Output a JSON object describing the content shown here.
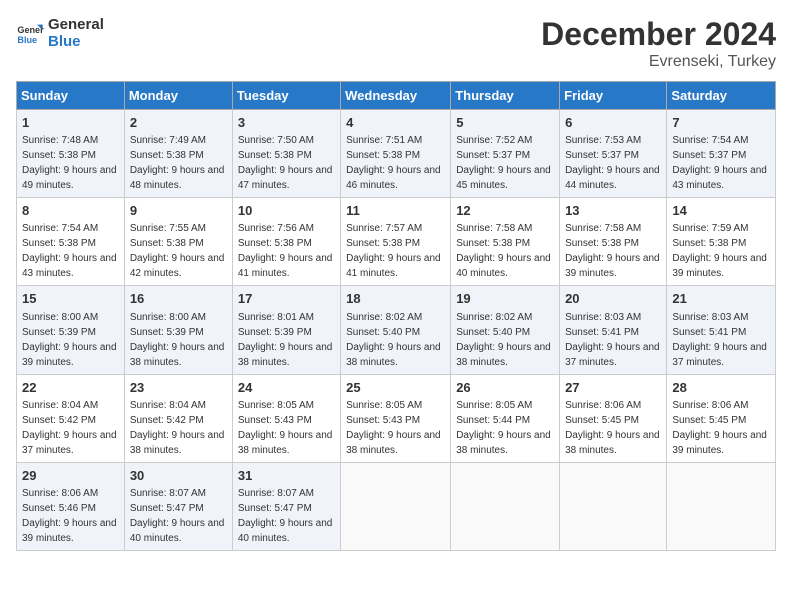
{
  "logo": {
    "line1": "General",
    "line2": "Blue"
  },
  "title": "December 2024",
  "location": "Evrenseki, Turkey",
  "days_of_week": [
    "Sunday",
    "Monday",
    "Tuesday",
    "Wednesday",
    "Thursday",
    "Friday",
    "Saturday"
  ],
  "weeks": [
    [
      {
        "day": "1",
        "sunrise": "Sunrise: 7:48 AM",
        "sunset": "Sunset: 5:38 PM",
        "daylight": "Daylight: 9 hours and 49 minutes."
      },
      {
        "day": "2",
        "sunrise": "Sunrise: 7:49 AM",
        "sunset": "Sunset: 5:38 PM",
        "daylight": "Daylight: 9 hours and 48 minutes."
      },
      {
        "day": "3",
        "sunrise": "Sunrise: 7:50 AM",
        "sunset": "Sunset: 5:38 PM",
        "daylight": "Daylight: 9 hours and 47 minutes."
      },
      {
        "day": "4",
        "sunrise": "Sunrise: 7:51 AM",
        "sunset": "Sunset: 5:38 PM",
        "daylight": "Daylight: 9 hours and 46 minutes."
      },
      {
        "day": "5",
        "sunrise": "Sunrise: 7:52 AM",
        "sunset": "Sunset: 5:37 PM",
        "daylight": "Daylight: 9 hours and 45 minutes."
      },
      {
        "day": "6",
        "sunrise": "Sunrise: 7:53 AM",
        "sunset": "Sunset: 5:37 PM",
        "daylight": "Daylight: 9 hours and 44 minutes."
      },
      {
        "day": "7",
        "sunrise": "Sunrise: 7:54 AM",
        "sunset": "Sunset: 5:37 PM",
        "daylight": "Daylight: 9 hours and 43 minutes."
      }
    ],
    [
      {
        "day": "8",
        "sunrise": "Sunrise: 7:54 AM",
        "sunset": "Sunset: 5:38 PM",
        "daylight": "Daylight: 9 hours and 43 minutes."
      },
      {
        "day": "9",
        "sunrise": "Sunrise: 7:55 AM",
        "sunset": "Sunset: 5:38 PM",
        "daylight": "Daylight: 9 hours and 42 minutes."
      },
      {
        "day": "10",
        "sunrise": "Sunrise: 7:56 AM",
        "sunset": "Sunset: 5:38 PM",
        "daylight": "Daylight: 9 hours and 41 minutes."
      },
      {
        "day": "11",
        "sunrise": "Sunrise: 7:57 AM",
        "sunset": "Sunset: 5:38 PM",
        "daylight": "Daylight: 9 hours and 41 minutes."
      },
      {
        "day": "12",
        "sunrise": "Sunrise: 7:58 AM",
        "sunset": "Sunset: 5:38 PM",
        "daylight": "Daylight: 9 hours and 40 minutes."
      },
      {
        "day": "13",
        "sunrise": "Sunrise: 7:58 AM",
        "sunset": "Sunset: 5:38 PM",
        "daylight": "Daylight: 9 hours and 39 minutes."
      },
      {
        "day": "14",
        "sunrise": "Sunrise: 7:59 AM",
        "sunset": "Sunset: 5:38 PM",
        "daylight": "Daylight: 9 hours and 39 minutes."
      }
    ],
    [
      {
        "day": "15",
        "sunrise": "Sunrise: 8:00 AM",
        "sunset": "Sunset: 5:39 PM",
        "daylight": "Daylight: 9 hours and 39 minutes."
      },
      {
        "day": "16",
        "sunrise": "Sunrise: 8:00 AM",
        "sunset": "Sunset: 5:39 PM",
        "daylight": "Daylight: 9 hours and 38 minutes."
      },
      {
        "day": "17",
        "sunrise": "Sunrise: 8:01 AM",
        "sunset": "Sunset: 5:39 PM",
        "daylight": "Daylight: 9 hours and 38 minutes."
      },
      {
        "day": "18",
        "sunrise": "Sunrise: 8:02 AM",
        "sunset": "Sunset: 5:40 PM",
        "daylight": "Daylight: 9 hours and 38 minutes."
      },
      {
        "day": "19",
        "sunrise": "Sunrise: 8:02 AM",
        "sunset": "Sunset: 5:40 PM",
        "daylight": "Daylight: 9 hours and 38 minutes."
      },
      {
        "day": "20",
        "sunrise": "Sunrise: 8:03 AM",
        "sunset": "Sunset: 5:41 PM",
        "daylight": "Daylight: 9 hours and 37 minutes."
      },
      {
        "day": "21",
        "sunrise": "Sunrise: 8:03 AM",
        "sunset": "Sunset: 5:41 PM",
        "daylight": "Daylight: 9 hours and 37 minutes."
      }
    ],
    [
      {
        "day": "22",
        "sunrise": "Sunrise: 8:04 AM",
        "sunset": "Sunset: 5:42 PM",
        "daylight": "Daylight: 9 hours and 37 minutes."
      },
      {
        "day": "23",
        "sunrise": "Sunrise: 8:04 AM",
        "sunset": "Sunset: 5:42 PM",
        "daylight": "Daylight: 9 hours and 38 minutes."
      },
      {
        "day": "24",
        "sunrise": "Sunrise: 8:05 AM",
        "sunset": "Sunset: 5:43 PM",
        "daylight": "Daylight: 9 hours and 38 minutes."
      },
      {
        "day": "25",
        "sunrise": "Sunrise: 8:05 AM",
        "sunset": "Sunset: 5:43 PM",
        "daylight": "Daylight: 9 hours and 38 minutes."
      },
      {
        "day": "26",
        "sunrise": "Sunrise: 8:05 AM",
        "sunset": "Sunset: 5:44 PM",
        "daylight": "Daylight: 9 hours and 38 minutes."
      },
      {
        "day": "27",
        "sunrise": "Sunrise: 8:06 AM",
        "sunset": "Sunset: 5:45 PM",
        "daylight": "Daylight: 9 hours and 38 minutes."
      },
      {
        "day": "28",
        "sunrise": "Sunrise: 8:06 AM",
        "sunset": "Sunset: 5:45 PM",
        "daylight": "Daylight: 9 hours and 39 minutes."
      }
    ],
    [
      {
        "day": "29",
        "sunrise": "Sunrise: 8:06 AM",
        "sunset": "Sunset: 5:46 PM",
        "daylight": "Daylight: 9 hours and 39 minutes."
      },
      {
        "day": "30",
        "sunrise": "Sunrise: 8:07 AM",
        "sunset": "Sunset: 5:47 PM",
        "daylight": "Daylight: 9 hours and 40 minutes."
      },
      {
        "day": "31",
        "sunrise": "Sunrise: 8:07 AM",
        "sunset": "Sunset: 5:47 PM",
        "daylight": "Daylight: 9 hours and 40 minutes."
      },
      null,
      null,
      null,
      null
    ]
  ]
}
